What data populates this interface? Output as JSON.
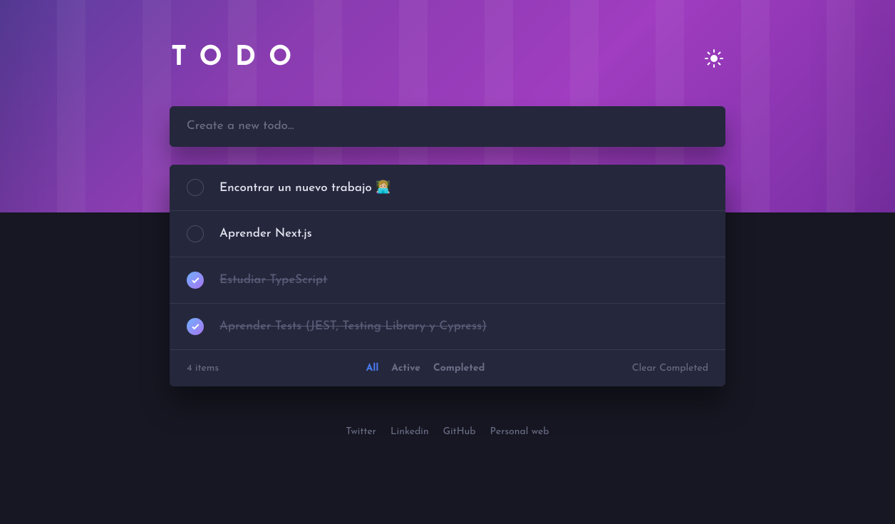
{
  "header": {
    "logo": "TODO"
  },
  "input": {
    "placeholder": "Create a new todo..."
  },
  "todos": [
    {
      "text": "Encontrar un nuevo trabajo 👩🏼‍💻",
      "completed": false
    },
    {
      "text": "Aprender Next.js",
      "completed": false
    },
    {
      "text": "Estudiar TypeScript",
      "completed": true
    },
    {
      "text": "Aprender Tests (JEST, Testing Library y Cypress)",
      "completed": true
    }
  ],
  "footer": {
    "items_count": "4 items",
    "filters": {
      "all": "All",
      "active": "Active",
      "completed": "Completed"
    },
    "clear_completed": "Clear Completed"
  },
  "social": {
    "twitter": "Twitter",
    "linkedin": "Linkedin",
    "github": "GitHub",
    "personal": "Personal web"
  }
}
